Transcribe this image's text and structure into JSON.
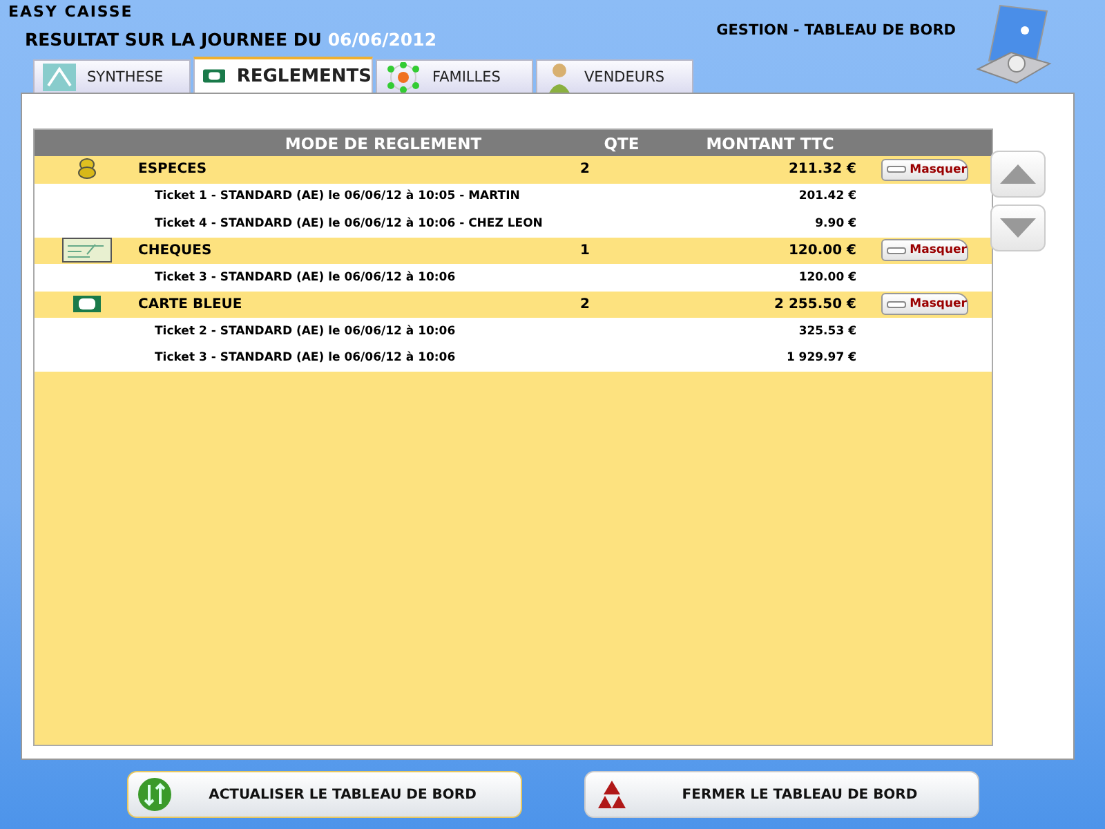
{
  "app_title": "EASY CAISSE",
  "header": {
    "title": "RESULTAT SUR LA JOURNEE DU",
    "date": "06/06/2012",
    "section": "GESTION - TABLEAU DE BORD"
  },
  "tabs": [
    {
      "label": "SYNTHESE",
      "selected": false
    },
    {
      "label": "REGLEMENTS",
      "selected": true
    },
    {
      "label": "FAMILLES",
      "selected": false
    },
    {
      "label": "VENDEURS",
      "selected": false
    }
  ],
  "table": {
    "columns": [
      "MODE DE REGLEMENT",
      "QTE",
      "MONTANT TTC"
    ],
    "groups": [
      {
        "name": "ESPECES",
        "qty": "2",
        "amount": "211.32 €",
        "action": "Masquer",
        "expanded": true,
        "tickets": [
          {
            "label": "Ticket 1 - STANDARD (AE) le 06/06/12 à 10:05 - MARTIN",
            "amount": "201.42 €"
          },
          {
            "label": "Ticket 4 - STANDARD (AE) le 06/06/12 à 10:06 - CHEZ LEON",
            "amount": "9.90 €"
          }
        ]
      },
      {
        "name": "CHEQUES",
        "qty": "1",
        "amount": "120.00 €",
        "action": "Masquer",
        "expanded": true,
        "tickets": [
          {
            "label": "Ticket 3 - STANDARD (AE) le 06/06/12 à 10:06",
            "amount": "120.00 €"
          }
        ]
      },
      {
        "name": "CARTE BLEUE",
        "qty": "2",
        "amount": "2 255.50 €",
        "action": "Masquer",
        "expanded": true,
        "tickets": [
          {
            "label": "Ticket 2 - STANDARD (AE) le 06/06/12 à 10:06",
            "amount": "325.53 €"
          },
          {
            "label": "Ticket 3 - STANDARD (AE) le 06/06/12 à 10:06",
            "amount": "1 929.97 €"
          }
        ]
      }
    ]
  },
  "buttons": [
    "ACTUALISER LE TABLEAU DE BORD",
    "FERMER LE TABLEAU DE BORD"
  ]
}
